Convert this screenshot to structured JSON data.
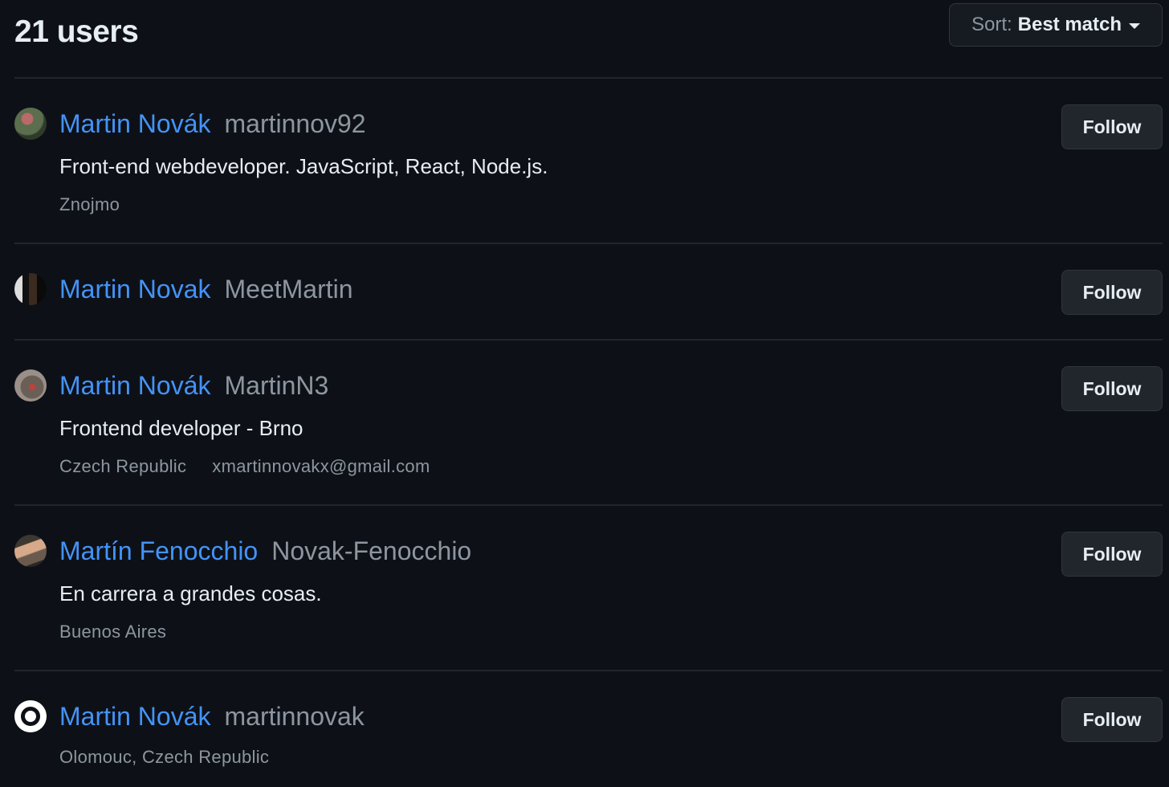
{
  "results": {
    "count_label": "21 users",
    "sort": {
      "prefix": "Sort:",
      "value": "Best match",
      "icon": "chevron-down-icon"
    }
  },
  "users": [
    {
      "name": "Martin Novák",
      "login": "martinnov92",
      "bio": "Front-end webdeveloper. JavaScript, React, Node.js.",
      "location": "Znojmo",
      "email": "",
      "follow_label": "Follow"
    },
    {
      "name": "Martin Novak",
      "login": "MeetMartin",
      "bio": "",
      "location": "",
      "email": "",
      "follow_label": "Follow"
    },
    {
      "name": "Martin Novák",
      "login": "MartinN3",
      "bio": "Frontend developer - Brno",
      "location": "Czech Republic",
      "email": "xmartinnovakx@gmail.com",
      "follow_label": "Follow"
    },
    {
      "name": "Martín Fenocchio",
      "login": "Novak-Fenocchio",
      "bio": "En carrera a grandes cosas.",
      "location": "Buenos Aires",
      "email": "",
      "follow_label": "Follow"
    },
    {
      "name": "Martin Novák",
      "login": "martinnovak",
      "bio": "",
      "location": "Olomouc, Czech Republic",
      "email": "",
      "follow_label": "Follow"
    }
  ]
}
